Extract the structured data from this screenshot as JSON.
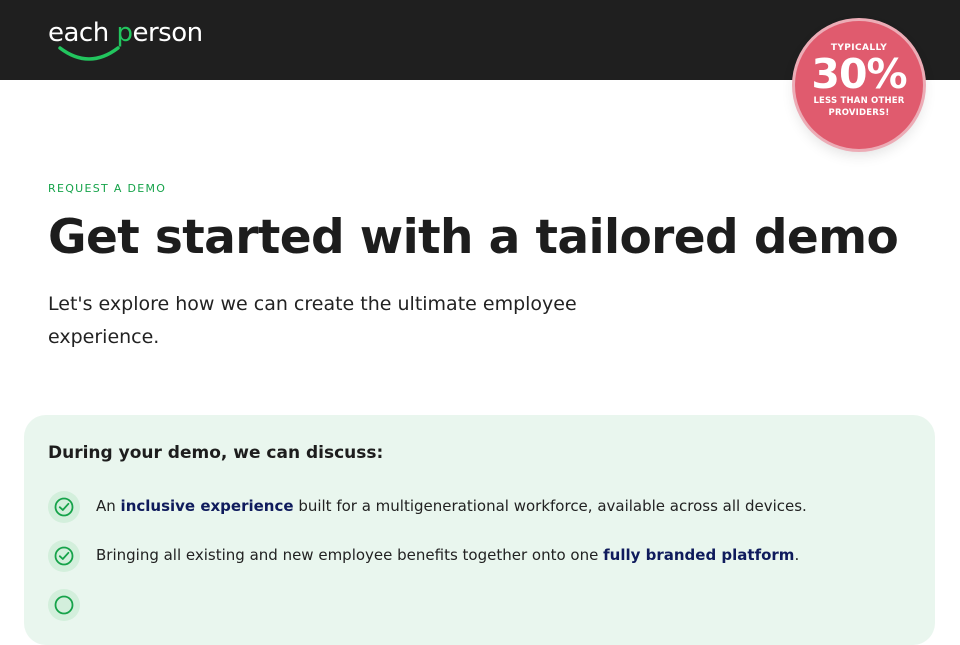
{
  "header": {
    "logo": {
      "part1": "each ",
      "part2": "p",
      "part3": "erson",
      "alt": "each person"
    }
  },
  "badge": {
    "top": "TYPICALLY",
    "big": "30%",
    "line1": "LESS THAN OTHER",
    "line2": "PROVIDERS!"
  },
  "hero": {
    "eyebrow": "REQUEST A DEMO",
    "title": "Get started with a tailored demo",
    "subtitle": "Let's explore how we can create the ultimate employee experience."
  },
  "discuss": {
    "heading": "During your demo, we can discuss:",
    "items": [
      {
        "pre": "An ",
        "bold": "inclusive experience",
        "post": " built for a multigenerational workforce, available across all devices."
      },
      {
        "pre": "Bringing all existing and new employee benefits together onto one ",
        "bold": "fully branded platform",
        "post": "."
      }
    ]
  },
  "colors": {
    "topbar": "#1f1f1f",
    "brand_green": "#22c55e",
    "badge_red": "#e05b6e",
    "card_bg": "#e9f6ee",
    "link_navy": "#0f1b5c"
  }
}
